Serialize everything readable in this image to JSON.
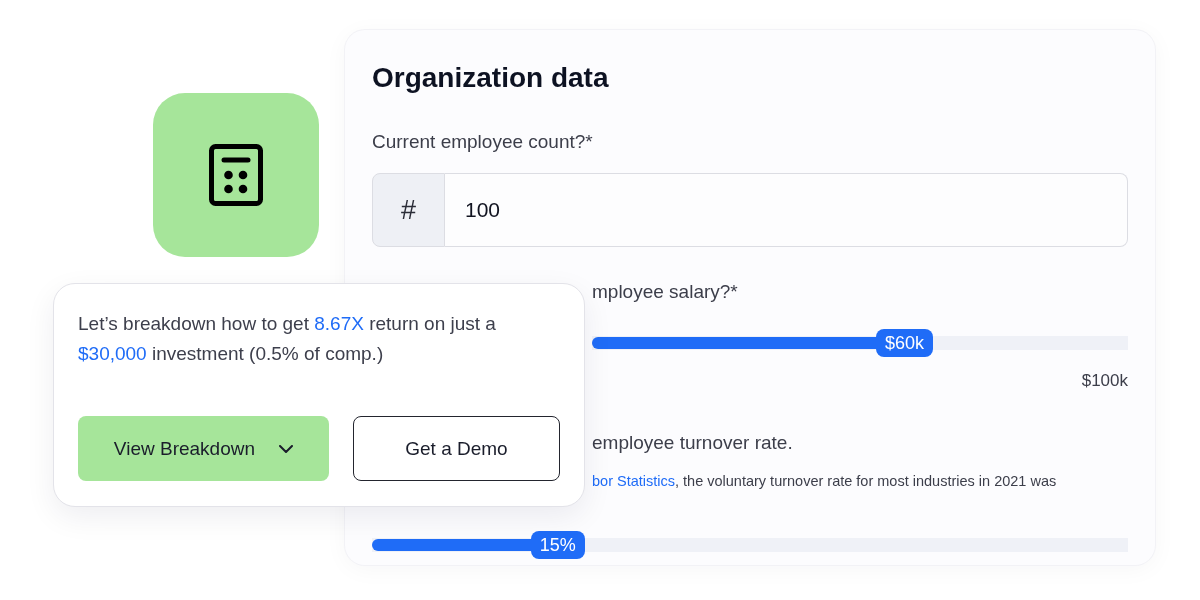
{
  "form": {
    "title": "Organization data",
    "employee_count": {
      "label": "Current employee count?*",
      "prefix": "#",
      "value": "100"
    },
    "salary": {
      "label": "mployee salary?*",
      "slider": {
        "level": 0.53,
        "value": "$60k"
      },
      "max": "$100k"
    },
    "turnover": {
      "label": "employee turnover rate.",
      "note": [
        {
          "kind": "link",
          "text": "bor Statistics"
        },
        {
          "kind": "text",
          "text": ", the voluntary turnover rate for most industries in 2021 was"
        }
      ],
      "slider": {
        "level": 0.21,
        "value": "15%"
      }
    }
  },
  "overlay_card": {
    "message": [
      {
        "text": "Let’s breakdown how to get ",
        "highlight": false
      },
      {
        "text": "8.67X",
        "highlight": true
      },
      {
        "text": " return on just a ",
        "highlight": false
      },
      {
        "text": "$30,000",
        "highlight": true
      },
      {
        "text": " investment (0.5% of comp.)",
        "highlight": false
      }
    ],
    "buttons": [
      {
        "label": "View Breakdown",
        "kind": "dropdown"
      },
      {
        "label": "Get a Demo",
        "kind": "outline"
      }
    ]
  }
}
